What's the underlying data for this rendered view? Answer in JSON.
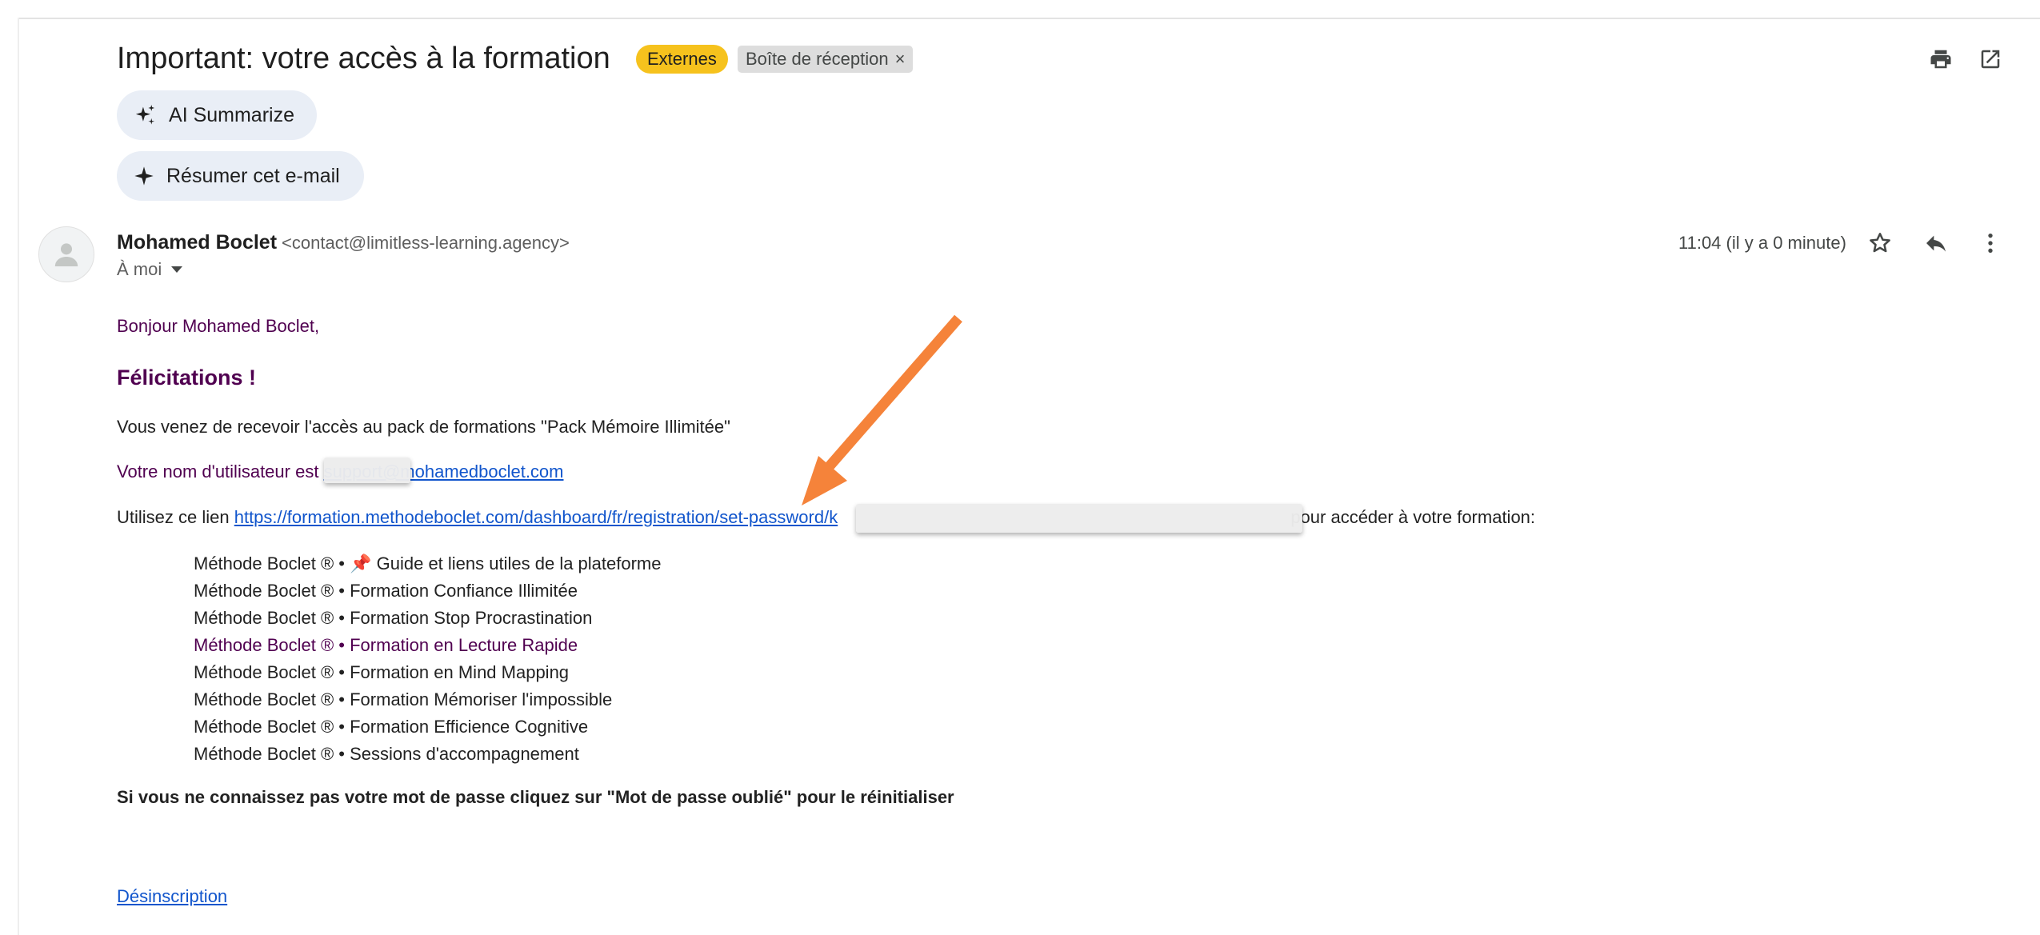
{
  "email": {
    "subject": "Important: votre accès à la formation",
    "labels": {
      "external": "Externes",
      "inbox": "Boîte de réception",
      "remove_label": "×"
    },
    "ai_summarize_label": "AI Summarize",
    "summarize_label": "Résumer cet e-mail",
    "sender_name": "Mohamed Boclet",
    "sender_email": "<contact@limitless-learning.agency>",
    "recipient": "À moi",
    "time": "11:04 (il y a 0 minute)",
    "body": {
      "greeting": "Bonjour Mohamed Boclet,",
      "congrats": "Félicitations !",
      "access": "Vous venez de recevoir l'accès au pack de formations \"Pack Mémoire Illimitée\"",
      "username_prefix": "Votre nom d'utilisateur est ",
      "username_hidden": "support",
      "username_domain": "@mohamedboclet.com",
      "link_prefix": "Utilisez ce lien ",
      "link_text": "https://formation.methodeboclet.com/dashboard/fr/registration/set-password/k",
      "link_suffix": " pour accéder à votre formation:",
      "courses": [
        "Méthode Boclet ® • 📌 Guide et liens utiles de la plateforme",
        "Méthode Boclet ® • Formation Confiance Illimitée",
        "Méthode Boclet ® • Formation Stop Procrastination",
        "Méthode Boclet ® • Formation en Lecture Rapide",
        "Méthode Boclet ® • Formation en Mind Mapping",
        "Méthode Boclet ® • Formation Mémoriser l'impossible",
        "Méthode Boclet ® • Formation Efficience Cognitive",
        "Méthode Boclet ® • Sessions d'accompagnement"
      ],
      "forgot": "Si vous ne connaissez pas votre mot de passe cliquez sur \"Mot de passe oublié\" pour le réinitialiser",
      "unsubscribe": "Désinscription"
    }
  },
  "icons": {
    "print": "print-icon",
    "open_new_window": "open-in-new-icon",
    "sparkle": "sparkle-icon",
    "avatar": "person-icon",
    "star": "star-icon",
    "reply": "reply-icon",
    "more": "more-vert-icon",
    "arrow": "annotation-arrow"
  },
  "colors": {
    "external_badge": "#f6c21d",
    "inbox_badge": "#dddddd",
    "chip_bg": "#e9eef6",
    "link": "#1155cc",
    "purple_text": "#500050",
    "annotation_arrow": "#f5833a"
  }
}
